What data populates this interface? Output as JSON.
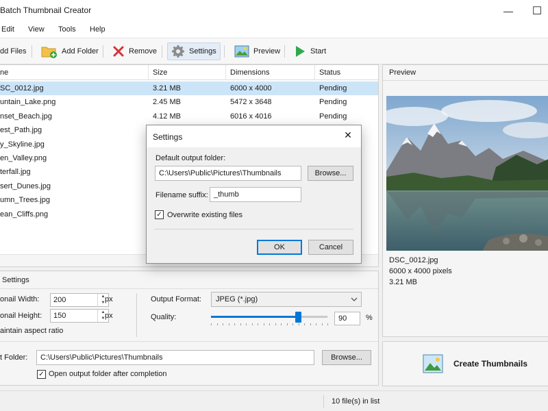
{
  "window": {
    "title": "e Batch Thumbnail Creator",
    "minimize": "—",
    "maximize": "☐"
  },
  "menu": [
    "Edit",
    "View",
    "Tools",
    "Help"
  ],
  "toolbar": {
    "add_files": "dd Files",
    "add_folder": "Add Folder",
    "remove": "Remove",
    "settings": "Settings",
    "preview": "Preview",
    "start": "Start"
  },
  "file_list": {
    "columns": [
      "ne",
      "Size",
      "Dimensions",
      "Status"
    ],
    "rows": [
      {
        "name": "SC_0012.jpg",
        "size": "3.21 MB",
        "dims": "6000 x 4000",
        "status": "Pending"
      },
      {
        "name": "untain_Lake.png",
        "size": "2.45 MB",
        "dims": "5472 x 3648",
        "status": "Pending"
      },
      {
        "name": "nset_Beach.jpg",
        "size": "4.12 MB",
        "dims": "6016 x 4016",
        "status": "Pending"
      },
      {
        "name": "est_Path.jpg",
        "size": "",
        "dims": "",
        "status": ""
      },
      {
        "name": "y_Skyline.jpg",
        "size": "",
        "dims": "",
        "status": ""
      },
      {
        "name": "en_Valley.png",
        "size": "",
        "dims": "",
        "status": ""
      },
      {
        "name": "terfall.jpg",
        "size": "",
        "dims": "",
        "status": ""
      },
      {
        "name": "sert_Dunes.jpg",
        "size": "",
        "dims": "",
        "status": ""
      },
      {
        "name": "umn_Trees.jpg",
        "size": "",
        "dims": "",
        "status": ""
      },
      {
        "name": "ean_Cliffs.png",
        "size": "",
        "dims": "",
        "status": ""
      }
    ]
  },
  "settings_group": {
    "title": "Settings",
    "width_label": "onail Width:",
    "width_value": "200",
    "height_label": "onail Height:",
    "height_value": "150",
    "unit": "px",
    "aspect_label": "aintain aspect ratio",
    "format_label": "Output Format:",
    "format_value": "JPEG (*.jpg)",
    "quality_label": "Quality:",
    "quality_value": "90",
    "quality_pct": 90,
    "pct": "%",
    "folder_label": "t Folder:",
    "folder_value": "C:\\Users\\Public\\Pictures\\Thumbnails",
    "browse": "Browse...",
    "open_after_label": "Open output folder after completion"
  },
  "preview": {
    "title": "Preview",
    "filename": "DSC_0012.jpg",
    "dimensions": "6000 x 4000 pixels",
    "size": "3.21 MB"
  },
  "create_button": "Create Thumbnails",
  "status": {
    "count": "10 file(s) in list"
  },
  "dialog": {
    "title": "Settings",
    "close": "✕",
    "output_label": "Default output folder:",
    "output_value": "C:\\Users\\Public\\Pictures\\Thumbnails",
    "browse": "Browse...",
    "suffix_label": "Filename suffix:",
    "suffix_value": "_thumb",
    "overwrite_label": "Overwrite existing files",
    "ok": "OK",
    "cancel": "Cancel"
  },
  "colors": {
    "accent": "#0078d7",
    "selection": "#cce4f7"
  }
}
